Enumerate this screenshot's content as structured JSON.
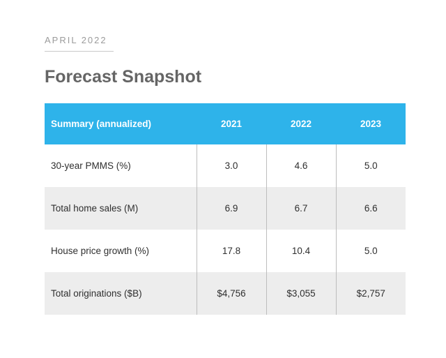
{
  "header": {
    "eyebrow": "APRIL 2022",
    "title": "Forecast Snapshot"
  },
  "colors": {
    "header_blue": "#2eb3ea",
    "row_shade": "#ededed",
    "divider": "#bdbdbd",
    "title_gray": "#656565",
    "eyebrow_gray": "#9b9b9b",
    "body_text": "#2f2f2f",
    "page_background": "#ffffff"
  },
  "table": {
    "columns": [
      {
        "key": "label",
        "label": "Summary (annualized)"
      },
      {
        "key": "y2021",
        "label": "2021"
      },
      {
        "key": "y2022",
        "label": "2022"
      },
      {
        "key": "y2023",
        "label": "2023"
      }
    ],
    "rows": [
      {
        "label": "30-year PMMS (%)",
        "values": [
          "3.0",
          "4.6",
          "5.0"
        ],
        "shaded": false
      },
      {
        "label": "Total home sales (M)",
        "values": [
          "6.9",
          "6.7",
          "6.6"
        ],
        "shaded": true
      },
      {
        "label": "House price growth (%)",
        "values": [
          "17.8",
          "10.4",
          "5.0"
        ],
        "shaded": false
      },
      {
        "label": "Total originations ($B)",
        "values": [
          "$4,756",
          "$3,055",
          "$2,757"
        ],
        "shaded": true
      }
    ]
  },
  "chart_data": {
    "type": "table",
    "title": "Forecast Snapshot",
    "subtitle": "APRIL 2022",
    "categories": [
      "2021",
      "2022",
      "2023"
    ],
    "series": [
      {
        "name": "30-year PMMS (%)",
        "values": [
          3.0,
          4.6,
          5.0
        ]
      },
      {
        "name": "Total home sales (M)",
        "values": [
          6.9,
          6.7,
          6.6
        ]
      },
      {
        "name": "House price growth (%)",
        "values": [
          17.8,
          10.4,
          5.0
        ]
      },
      {
        "name": "Total originations ($B)",
        "values": [
          4756,
          3055,
          2757
        ]
      }
    ],
    "row_header": "Summary (annualized)",
    "xlabel": "",
    "ylabel": "",
    "grid": false,
    "legend": "none"
  }
}
